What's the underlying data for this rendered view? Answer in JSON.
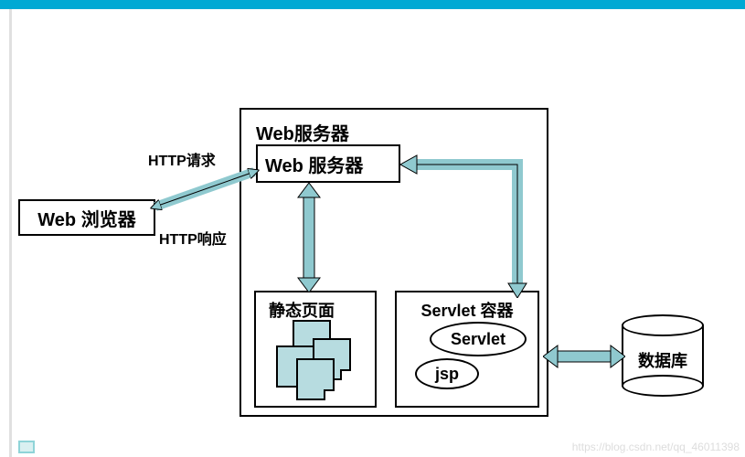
{
  "browser_label": "Web 浏览器",
  "server_container_title": "Web服务器",
  "web_server_box": "Web 服务器",
  "http_request": "HTTP请求",
  "http_response": "HTTP响应",
  "static_pages": "静态页面",
  "servlet_container": "Servlet 容器",
  "servlet": "Servlet",
  "jsp": "jsp",
  "database": "数据库",
  "watermark": "https://blog.csdn.net/qq_46011398"
}
